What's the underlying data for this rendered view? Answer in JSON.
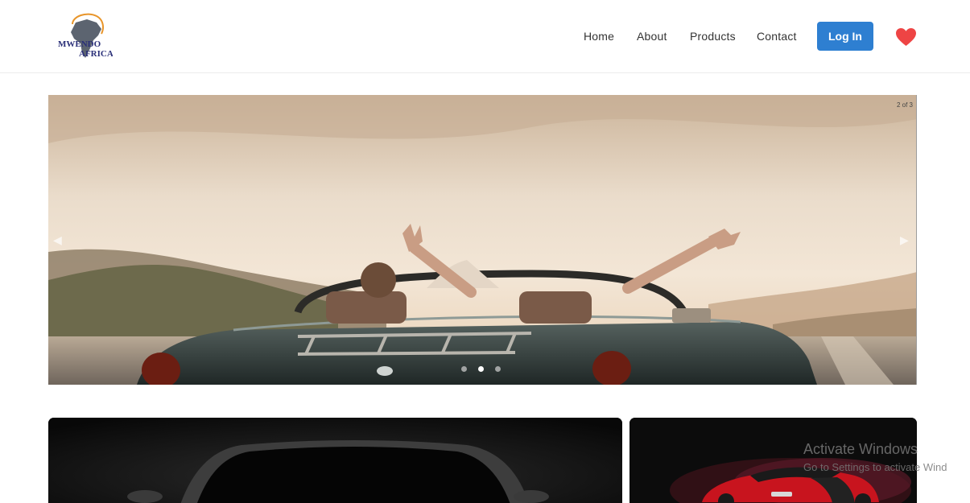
{
  "brand": {
    "logo_line1": "MWENDO",
    "logo_line2": "AFRICA"
  },
  "nav": {
    "items": [
      {
        "label": "Home"
      },
      {
        "label": "About"
      },
      {
        "label": "Products"
      },
      {
        "label": "Contact"
      }
    ],
    "login_label": "Log In",
    "favorites_icon": "heart-icon",
    "accent_color": "#2e7fd1",
    "heart_color": "#ee4444"
  },
  "carousel": {
    "counter": "2 of 3",
    "slide_count": 3,
    "active_slide": 2
  },
  "watermark": {
    "title": "Activate Windows",
    "subtitle": "Go to Settings to activate Wind"
  }
}
